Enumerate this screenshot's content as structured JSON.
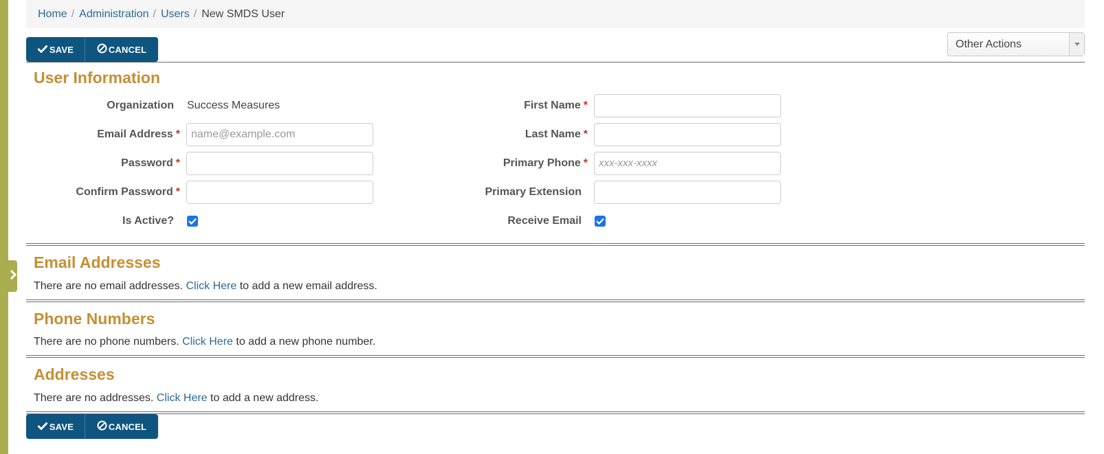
{
  "breadcrumb": {
    "items": [
      "Home",
      "Administration",
      "Users"
    ],
    "separator": "/",
    "current": "New SMDS User"
  },
  "toolbar": {
    "save_label": "SAVE",
    "cancel_label": "CANCEL",
    "other_actions_label": "Other Actions"
  },
  "user_info": {
    "title": "User Information",
    "organization_label": "Organization",
    "organization_value": "Success Measures",
    "email_label": "Email Address",
    "email_placeholder": "name@example.com",
    "password_label": "Password",
    "confirm_password_label": "Confirm Password",
    "is_active_label": "Is Active?",
    "is_active_checked": true,
    "first_name_label": "First Name",
    "last_name_label": "Last Name",
    "primary_phone_label": "Primary Phone",
    "primary_phone_placeholder": "xxx-xxx-xxxx",
    "primary_extension_label": "Primary Extension",
    "receive_email_label": "Receive Email",
    "receive_email_checked": true,
    "required_marker": "*"
  },
  "email_addresses": {
    "title": "Email Addresses",
    "empty_prefix": "There are no email addresses.",
    "link_text": "Click Here",
    "empty_suffix": "to add a new email address."
  },
  "phone_numbers": {
    "title": "Phone Numbers",
    "empty_prefix": "There are no phone numbers.",
    "link_text": "Click Here",
    "empty_suffix": "to add a new phone number."
  },
  "addresses": {
    "title": "Addresses",
    "empty_prefix": "There are no addresses.",
    "link_text": "Click Here",
    "empty_suffix": "to add a new address."
  },
  "colors": {
    "primary_button": "#0e5580",
    "section_title": "#c48f35",
    "link": "#2a6a97",
    "rail": "#a9ad4e",
    "required": "#c0392b",
    "checkbox": "#1e73e8"
  }
}
